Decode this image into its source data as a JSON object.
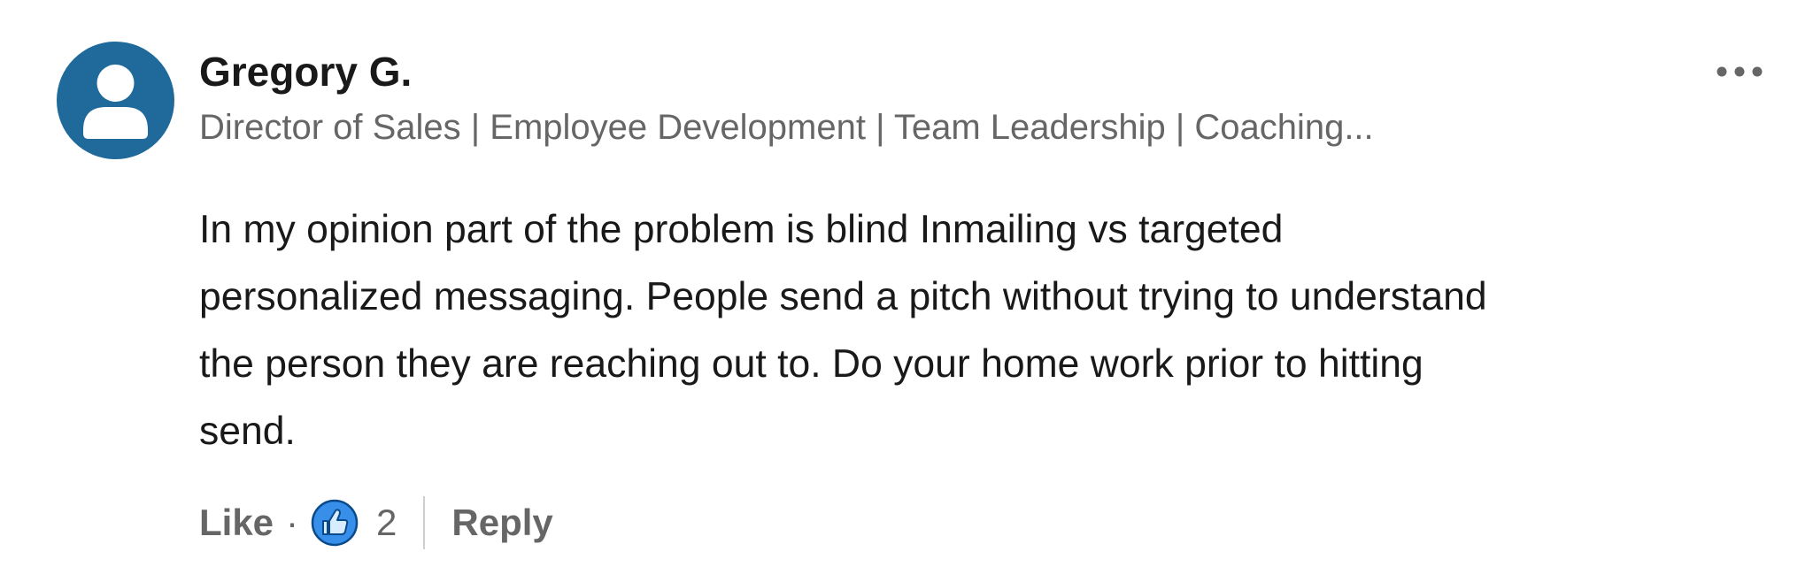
{
  "author": {
    "name": "Gregory G.",
    "headline": "Director of Sales | Employee Development | Team Leadership | Coaching...",
    "avatar_icon": "person-silhouette-icon",
    "avatar_color": "#1f6a9a"
  },
  "menu": {
    "icon": "more-horizontal-icon"
  },
  "comment": {
    "lines": [
      "In my opinion part of the problem is blind Inmailing vs targeted",
      "personalized messaging. People send a pitch without trying to understand",
      "the person they are reaching out to. Do your home work prior to hitting",
      "send."
    ]
  },
  "actions": {
    "like_label": "Like",
    "separator": "·",
    "reaction_icon": "thumbs-up-icon",
    "reaction_color": "#378fe9",
    "reaction_count": "2",
    "reply_label": "Reply"
  }
}
